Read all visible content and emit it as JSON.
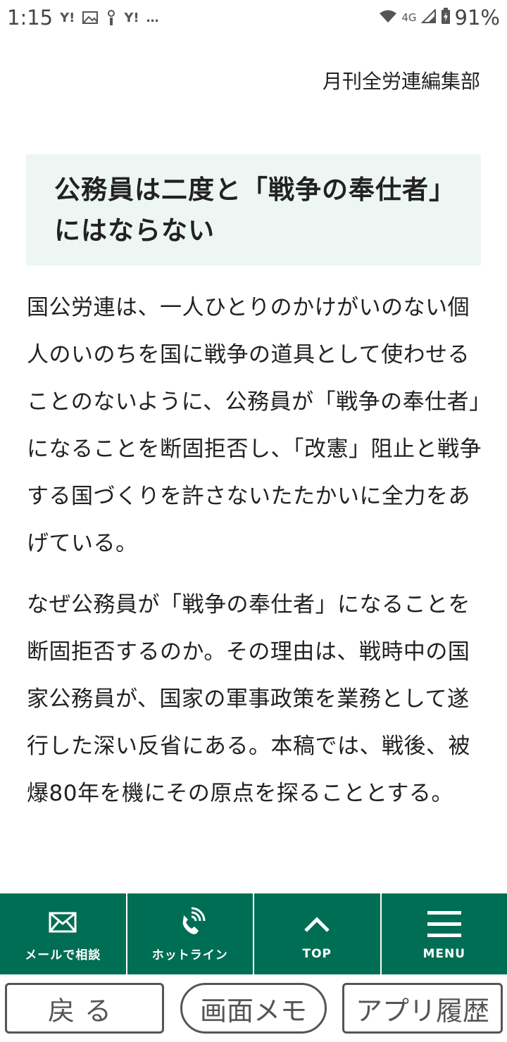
{
  "status_bar": {
    "time": "1:15",
    "notifications": [
      "Y!",
      "image-icon",
      "info-icon",
      "Y!",
      "…"
    ],
    "network": "4G",
    "battery": "91%"
  },
  "article": {
    "author": "月刊全労連編集部",
    "heading": "公務員は二度と「戦争の奉仕者」にはならない",
    "paragraphs": [
      "国公労連は、一人ひとりのかけがいのない個人のいのちを国に戦争の道具として使わせることのないように、公務員が「戦争の奉仕者」になることを断固拒否し、「改憲」阻止と戦争する国づくりを許さないたたかいに全力をあげている。",
      "なぜ公務員が「戦争の奉仕者」になることを断固拒否するのか。その理由は、戦時中の国家公務員が、国家の軍事政策を業務として遂行した深い反省にある。本稿では、戦後、被爆80年を機にその原点を探ることとする。"
    ]
  },
  "bottom_nav": {
    "items": [
      {
        "label": "メールで相談",
        "icon": "mail-icon"
      },
      {
        "label": "ホットライン",
        "icon": "phone-icon"
      },
      {
        "label": "TOP",
        "icon": "chevron-up-icon"
      },
      {
        "label": "MENU",
        "icon": "hamburger-menu-icon"
      }
    ]
  },
  "browser_bar": {
    "back": "戻る",
    "memo": "画面メモ",
    "history": "アプリ履歴"
  },
  "colors": {
    "nav_bg": "#006e54",
    "heading_bg": "#eef6f3"
  }
}
